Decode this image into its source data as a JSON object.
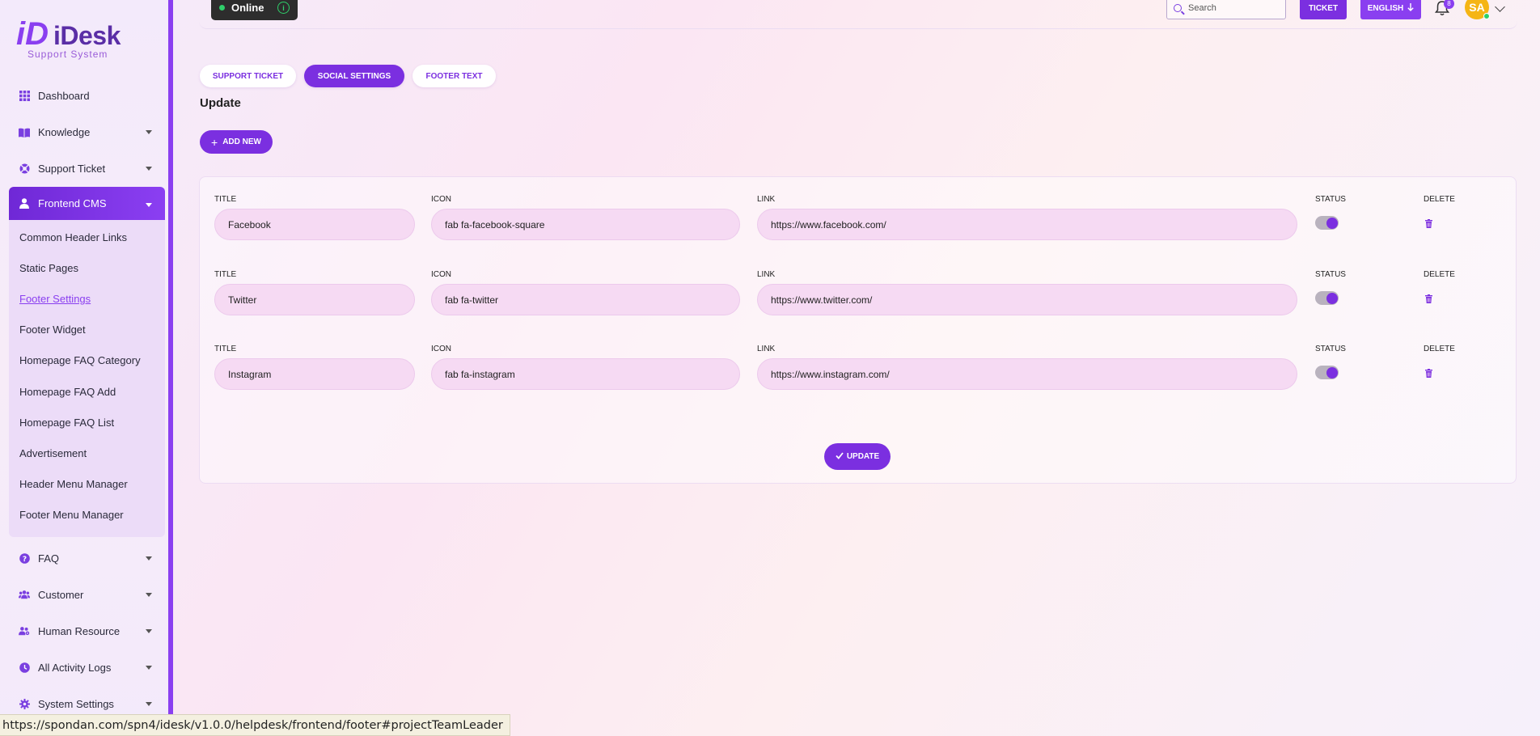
{
  "brand": {
    "mark": "iD",
    "name": "iDesk",
    "subtitle": "Support System"
  },
  "sidebar": {
    "items": [
      {
        "label": "Dashboard",
        "icon": "grid-icon"
      },
      {
        "label": "Knowledge",
        "icon": "book-icon"
      },
      {
        "label": "Support Ticket",
        "icon": "lifebuoy-icon"
      },
      {
        "label": "Frontend CMS",
        "icon": "user-icon"
      },
      {
        "label": "FAQ",
        "icon": "question-icon"
      },
      {
        "label": "Customer",
        "icon": "users-icon"
      },
      {
        "label": "Human Resource",
        "icon": "users-cog-icon"
      },
      {
        "label": "All Activity Logs",
        "icon": "clock-icon"
      },
      {
        "label": "System Settings",
        "icon": "gear-icon"
      }
    ],
    "submenu": [
      "Common Header Links",
      "Static Pages",
      "Footer Settings",
      "Footer Widget",
      "Homepage FAQ Category",
      "Homepage FAQ Add",
      "Homepage FAQ List",
      "Advertisement",
      "Header Menu Manager",
      "Footer Menu Manager"
    ]
  },
  "topbar": {
    "status": "Online",
    "search_placeholder": "Search",
    "ticket_label": "TICKET",
    "language_label": "ENGLISH",
    "notification_count": "8",
    "avatar_initials": "SA"
  },
  "tabs": [
    "SUPPORT TICKET",
    "SOCIAL SETTINGS",
    "FOOTER TEXT"
  ],
  "page_title": "Update",
  "add_new_label": "ADD NEW",
  "columns": {
    "title": "TITLE",
    "icon": "ICON",
    "link": "LINK",
    "status": "STATUS",
    "delete": "DELETE"
  },
  "rows": [
    {
      "title": "Facebook",
      "icon": "fab fa-facebook-square",
      "link": "https://www.facebook.com/"
    },
    {
      "title": "Twitter",
      "icon": "fab fa-twitter",
      "link": "https://www.twitter.com/"
    },
    {
      "title": "Instagram",
      "icon": "fab fa-instagram",
      "link": "https://www.instagram.com/"
    }
  ],
  "update_label": "UPDATE",
  "status_url": "https://spondan.com/spn4/idesk/v1.0.0/helpdesk/frontend/footer#projectTeamLeader",
  "colors": {
    "accent": "#7b2fe0",
    "online": "#2fcf6a",
    "avatar": "#f5b515"
  }
}
